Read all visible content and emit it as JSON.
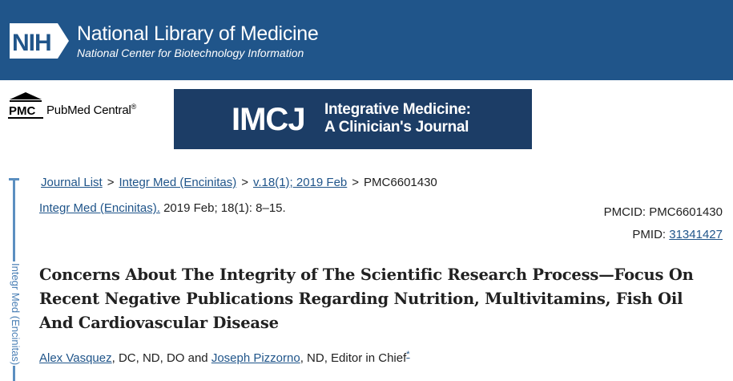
{
  "header": {
    "logo_text": "NIH",
    "title": "National Library of Medicine",
    "subtitle": "National Center for Biotechnology Information",
    "bg_color": "#20558a"
  },
  "pmc": {
    "logo_text": "PMC",
    "name": "PubMed Central",
    "reg_mark": "®"
  },
  "journal_banner": {
    "abbr": "IMCJ",
    "line1": "Integrative Medicine:",
    "line2": "A Clinician's Journal",
    "bg_color": "#1c3d66"
  },
  "side_label": "Integr Med (Encinitas)",
  "breadcrumb": {
    "items": [
      "Journal List",
      "Integr Med (Encinitas)",
      "v.18(1); 2019 Feb"
    ],
    "current": "PMC6601430",
    "separator": ">"
  },
  "citation": {
    "journal_link": "Integr Med (Encinitas).",
    "details": " 2019 Feb; 18(1): 8–15."
  },
  "ids": {
    "pmcid": "PMCID: PMC6601430",
    "pmid_label": "PMID: ",
    "pmid_value": "31341427"
  },
  "article": {
    "title": "Concerns About The Integrity of The Scientific Research Process—Focus On Recent Negative Publications Regarding Nutrition, Multivitamins, Fish Oil And Cardiovascular Disease"
  },
  "authors": {
    "author1": "Alex Vasquez",
    "author1_creds": ", DC, ND, DO and ",
    "author2": "Joseph Pizzorno",
    "author2_creds": ", ND, Editor in Chief",
    "footnote_mark": "*"
  }
}
